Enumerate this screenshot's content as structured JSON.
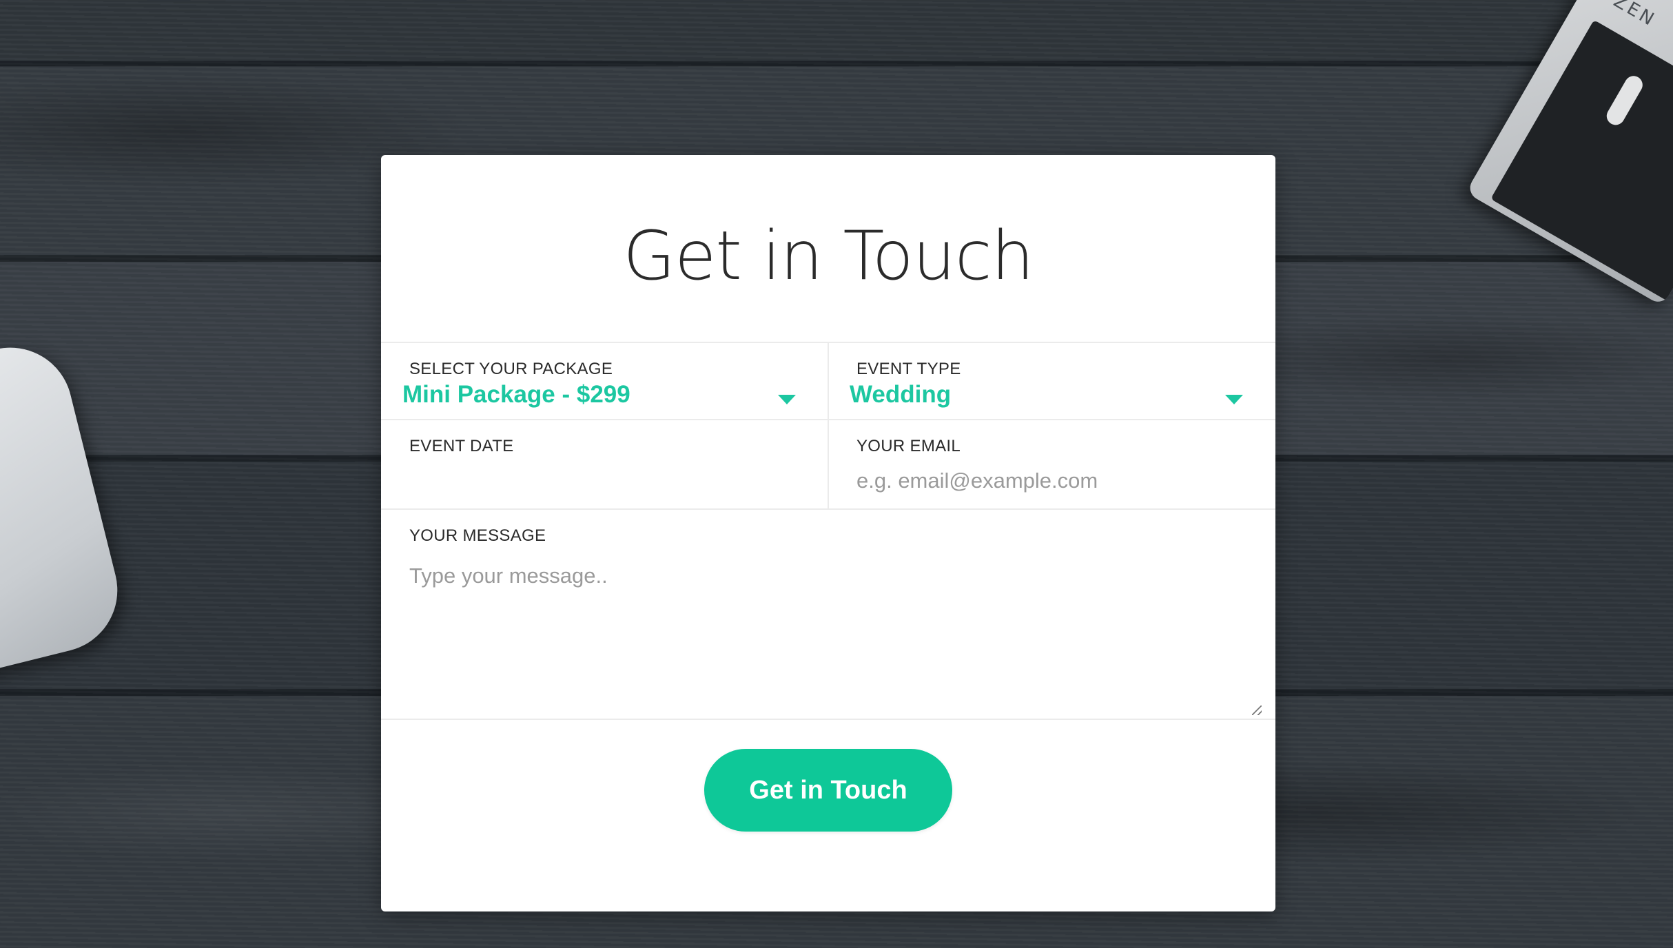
{
  "form": {
    "title": "Get in Touch",
    "package": {
      "label": "SELECT YOUR PACKAGE",
      "selected": "Mini Package - $299"
    },
    "event_type": {
      "label": "EVENT TYPE",
      "selected": "Wedding"
    },
    "event_date": {
      "label": "EVENT DATE",
      "value": ""
    },
    "email": {
      "label": "YOUR EMAIL",
      "placeholder": "e.g. email@example.com"
    },
    "message": {
      "label": "YOUR MESSAGE",
      "placeholder": "Type your message.."
    },
    "submit_label": "Get in Touch"
  },
  "background": {
    "camera_brand": "ZEN"
  },
  "colors": {
    "accent": "#1cc7a1",
    "button": "#0ec898",
    "card": "#ffffff",
    "title_text": "#2b2b2b"
  },
  "icons": {
    "package_caret": "caret-down-icon",
    "event_type_caret": "caret-down-icon",
    "message_resize": "resize-grip-icon"
  }
}
